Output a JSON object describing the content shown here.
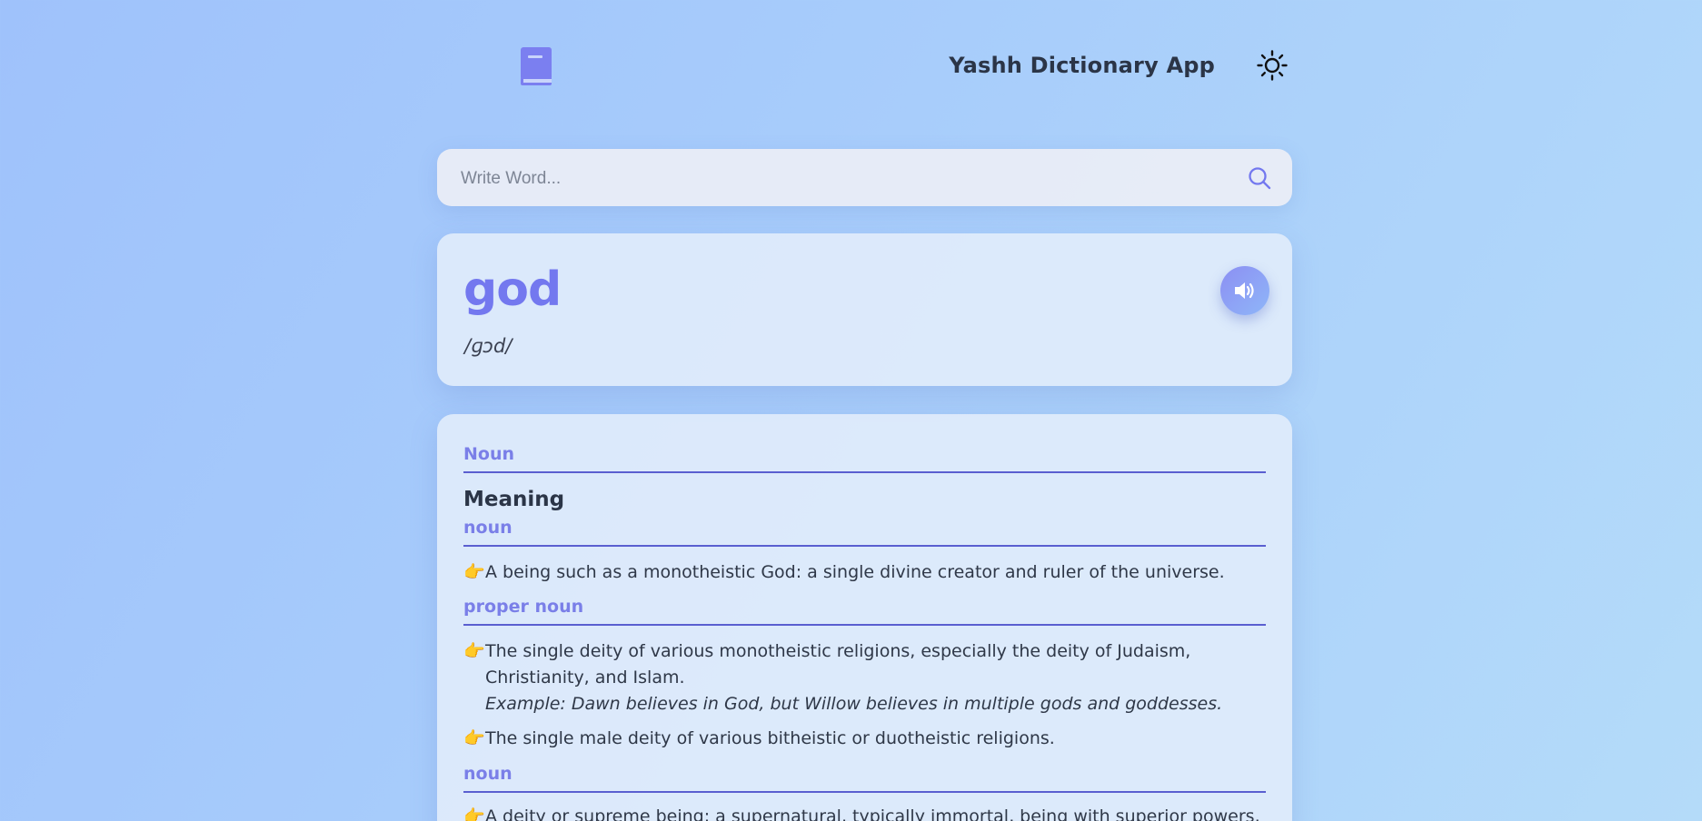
{
  "header": {
    "app_title": "Yashh Dictionary App",
    "logo_icon": "book-icon",
    "theme_icon": "sun-icon"
  },
  "search": {
    "placeholder": "Write Word...",
    "value": "",
    "icon": "search-icon"
  },
  "word": {
    "text": "god",
    "phonetic": "/ɡɔd/",
    "audio_icon": "speaker-icon"
  },
  "meanings": {
    "part_of_speech": "Noun",
    "meaning_label": "Meaning",
    "groups": [
      {
        "label": "noun",
        "definitions": [
          {
            "pointer": "👉",
            "text": "A being such as a monotheistic God: a single divine creator and ruler of the universe."
          }
        ]
      },
      {
        "label": "proper noun",
        "definitions": [
          {
            "pointer": "👉",
            "text": "The single deity of various monotheistic religions, especially the deity of Judaism, Christianity, and Islam.",
            "example": "Example: Dawn believes in God, but Willow believes in multiple gods and goddesses."
          },
          {
            "pointer": "👉",
            "text": "The single male deity of various bitheistic or duotheistic religions."
          }
        ]
      },
      {
        "label": "noun",
        "definitions": [
          {
            "pointer": "👉",
            "text": "A deity or supreme being; a supernatural, typically immortal, being with superior powers, to"
          }
        ]
      }
    ]
  },
  "colors": {
    "accent": "#7378ef",
    "divider": "#5a5fd0",
    "text": "#2b3547"
  }
}
